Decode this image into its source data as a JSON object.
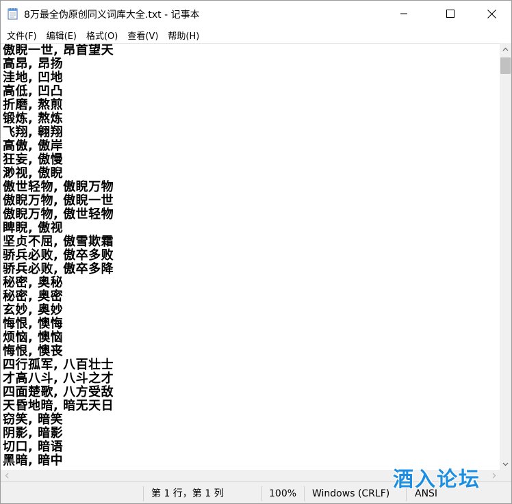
{
  "window": {
    "title": "8万最全伪原创同义词库大全.txt - 记事本"
  },
  "menu": {
    "items": [
      "文件(F)",
      "编辑(E)",
      "格式(O)",
      "查看(V)",
      "帮助(H)"
    ]
  },
  "editor": {
    "lines": [
      "傲睨一世, 昂首望天",
      "高昂, 昂扬",
      "洼地, 凹地",
      "高低, 凹凸",
      "折磨, 熬煎",
      "锻炼, 熬炼",
      "飞翔, 翱翔",
      "高傲, 傲岸",
      "狂妄, 傲慢",
      "渺视, 傲睨",
      "傲世轻物, 傲睨万物",
      "傲睨万物, 傲睨一世",
      "傲睨万物, 傲世轻物",
      "睥睨, 傲视",
      "坚贞不屈, 傲雪欺霜",
      "骄兵必败, 傲卒多败",
      "骄兵必败, 傲卒多降",
      "秘密, 奥秘",
      "秘密, 奥密",
      "玄妙, 奥妙",
      "悔恨, 懊悔",
      "烦恼, 懊恼",
      "悔恨, 懊丧",
      "四行孤军, 八百壮士",
      "才高八斗, 八斗之才",
      "四面楚歌, 八方受敌",
      "天昏地暗, 暗无天日",
      "窃笑, 暗笑",
      "阴影, 暗影",
      "切口, 暗语",
      "黑暗, 暗中"
    ]
  },
  "status": {
    "position": "第 1 行，第 1 列",
    "zoom": "100%",
    "line_ending": "Windows (CRLF)",
    "encoding": "ANSI"
  },
  "watermark": {
    "text": "酒入论坛"
  },
  "colors": {
    "watermark": "#1e8fe0",
    "statusbar_bg": "#f0f0f0",
    "scrollbar_thumb": "#c1c1c1"
  }
}
